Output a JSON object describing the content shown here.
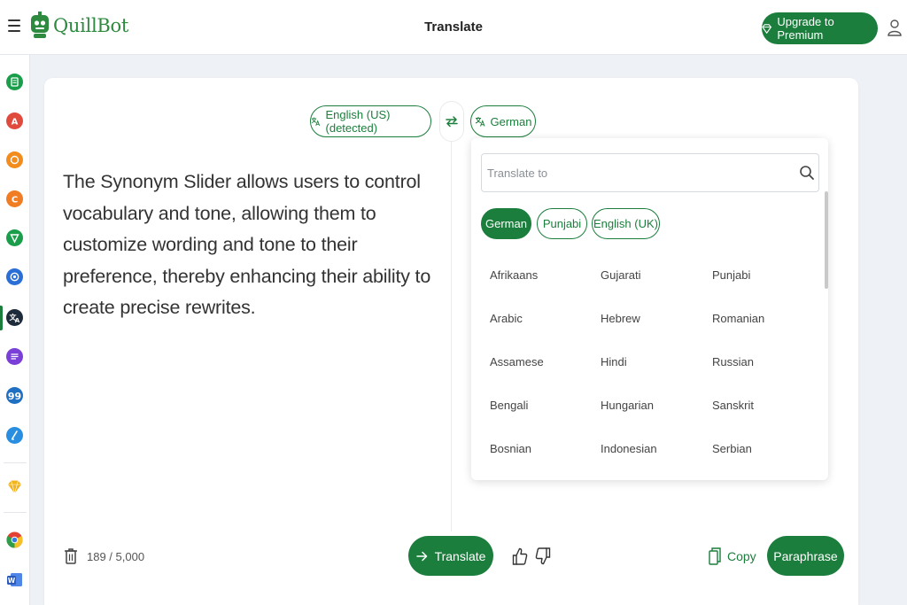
{
  "header": {
    "logo_text": "QuillBot",
    "page_title": "Translate",
    "upgrade_label": "Upgrade to Premium"
  },
  "sidebar": {
    "items": [
      {
        "name": "paraphraser",
        "color": "#1b9e4b",
        "icon": "document-icon"
      },
      {
        "name": "grammar-checker",
        "color": "#e04a3c",
        "icon": "grammar-icon"
      },
      {
        "name": "ai-detector",
        "color": "#f28c1c",
        "icon": "ai-detector-icon"
      },
      {
        "name": "plagiarism-checker",
        "color": "#f07c24",
        "icon": "plagiarism-icon"
      },
      {
        "name": "ai-humanizer",
        "color": "#1b9e4b",
        "icon": "humanizer-icon"
      },
      {
        "name": "ai-chat",
        "color": "#2a6fd6",
        "icon": "chat-icon"
      },
      {
        "name": "translator",
        "color": "#1e2b3a",
        "icon": "translate-icon"
      },
      {
        "name": "summarizer",
        "color": "#7a3fd6",
        "icon": "summarizer-icon"
      },
      {
        "name": "citation-generator",
        "color": "#1f6fc2",
        "icon": "citation-icon"
      },
      {
        "name": "quillbot-flow",
        "color": "#2a8ee0",
        "icon": "flow-icon"
      },
      {
        "name": "premium",
        "color": "#f2b31c",
        "icon": "diamond-icon"
      },
      {
        "name": "chrome-extension",
        "color": "#e34133",
        "icon": "chrome-icon"
      },
      {
        "name": "word-addin",
        "color": "#2b5ab9",
        "icon": "word-icon"
      }
    ]
  },
  "translator": {
    "source_lang_label": "English (US) (detected)",
    "target_lang_label": "German",
    "source_text": "The Synonym Slider allows users to control vocabulary and tone, allowing them to customize wording and tone to their preference, thereby enhancing their ability to create precise rewrites.",
    "char_count": "189 / 5,000",
    "translate_label": "Translate",
    "copy_label": "Copy",
    "paraphrase_label": "Paraphrase"
  },
  "dropdown": {
    "search_placeholder": "Translate to",
    "recent": [
      "German",
      "Punjabi",
      "English (UK)"
    ],
    "languages": [
      [
        "Afrikaans",
        "Gujarati",
        "Punjabi"
      ],
      [
        "Arabic",
        "Hebrew",
        "Romanian"
      ],
      [
        "Assamese",
        "Hindi",
        "Russian"
      ],
      [
        "Bengali",
        "Hungarian",
        "Sanskrit"
      ],
      [
        "Bosnian",
        "Indonesian",
        "Serbian"
      ]
    ]
  },
  "colors": {
    "brand_green": "#1b7e3c",
    "background": "#eef1f5"
  }
}
